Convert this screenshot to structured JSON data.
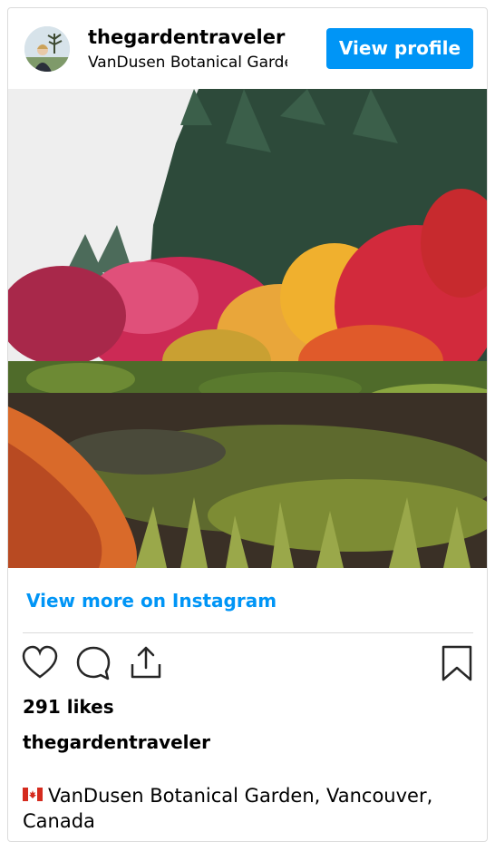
{
  "post": {
    "username": "thegardentraveler",
    "location": "VanDusen Botanical Garden",
    "view_profile_label": "View profile",
    "view_more_label": "View more on Instagram",
    "likes": "291 likes",
    "caption_user": "thegardentraveler",
    "caption_text": "VanDusen Botanical Garden, Vancouver, Canada"
  },
  "colors": {
    "accent": "#0095f6",
    "border": "#dbdbdb"
  },
  "icons": [
    "heart-icon",
    "comment-icon",
    "share-icon",
    "bookmark-icon",
    "canada-flag-icon"
  ]
}
